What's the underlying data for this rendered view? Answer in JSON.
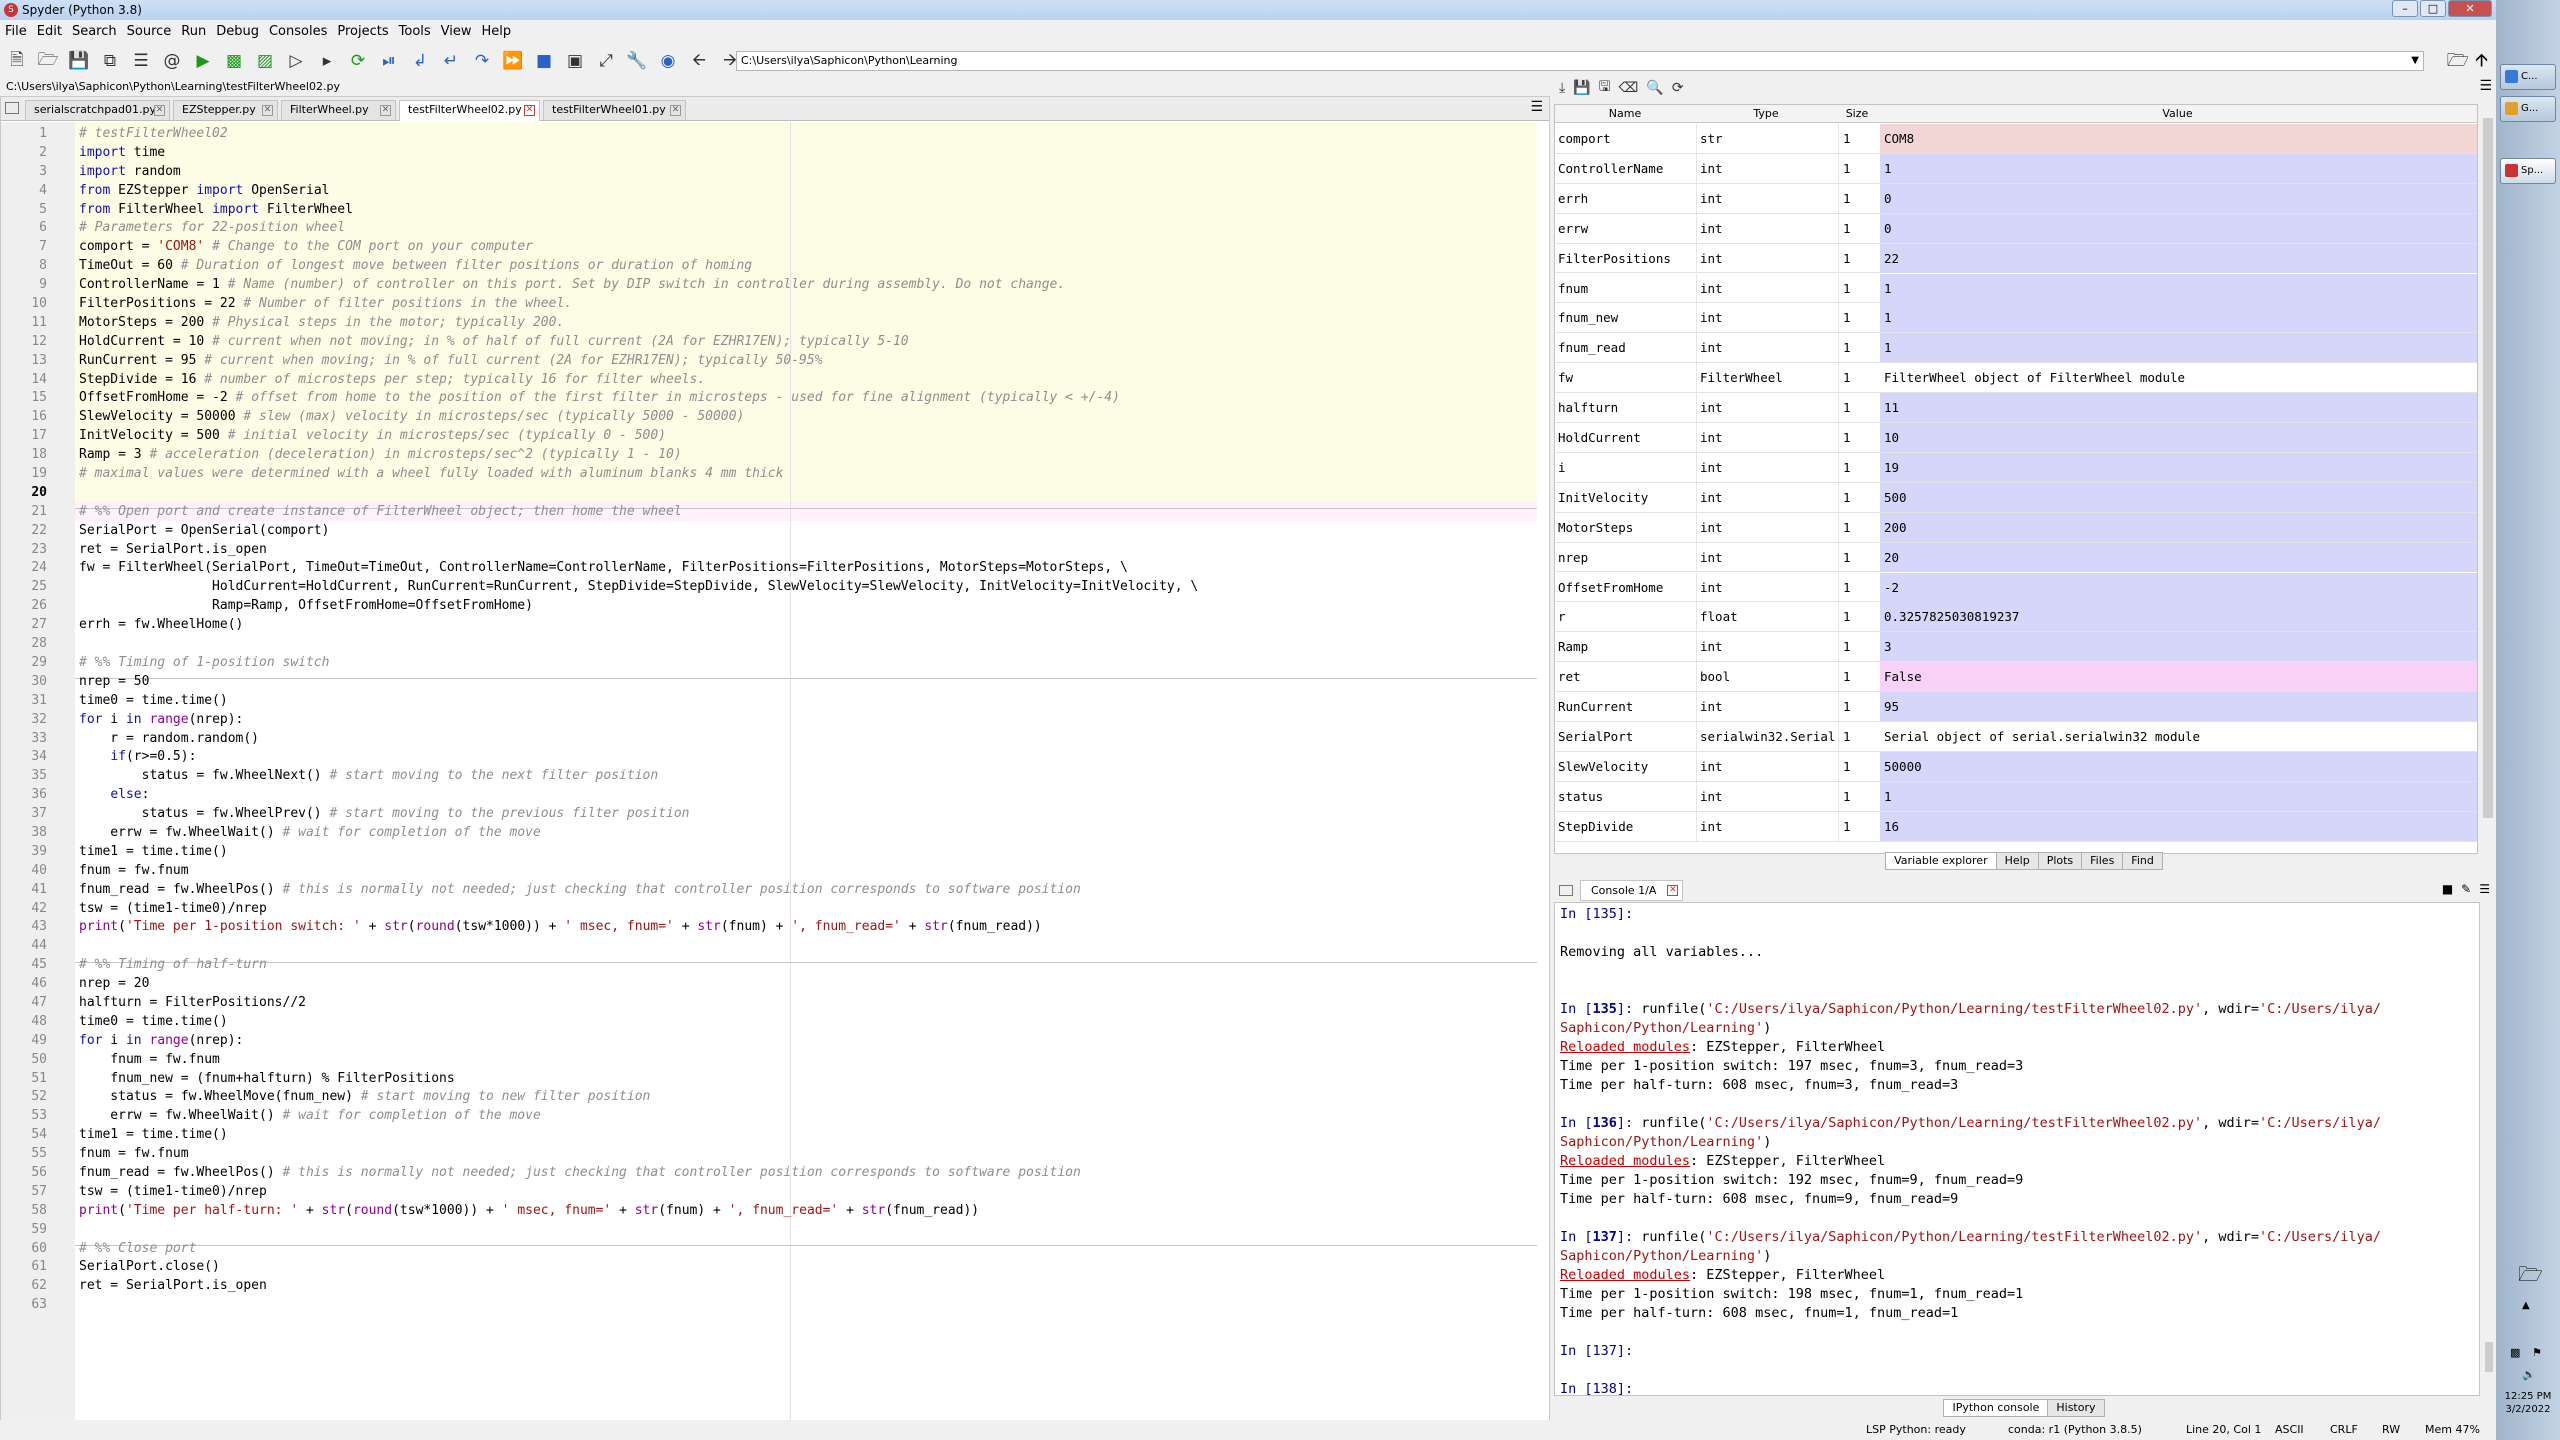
{
  "window": {
    "title": "Spyder (Python 3.8)"
  },
  "menu": [
    "File",
    "Edit",
    "Search",
    "Source",
    "Run",
    "Debug",
    "Consoles",
    "Projects",
    "Tools",
    "View",
    "Help"
  ],
  "toolbar": {
    "path": "C:\\Users\\ilya\\Saphicon\\Python\\Learning"
  },
  "editor": {
    "file_path": "C:\\Users\\ilya\\Saphicon\\Python\\Learning\\testFilterWheel02.py",
    "tabs": [
      "serialscratchpad01.py",
      "EZStepper.py",
      "FilterWheel.py",
      "testFilterWheel02.py",
      "testFilterWheel01.py"
    ],
    "active_tab": 3,
    "lines": [
      "# testFilterWheel02",
      "import time",
      "import random",
      "from EZStepper import OpenSerial",
      "from FilterWheel import FilterWheel",
      "# Parameters for 22-position wheel",
      "comport = 'COM8' # Change to the COM port on your computer",
      "TimeOut = 60 # Duration of longest move between filter positions or duration of homing",
      "ControllerName = 1 # Name (number) of controller on this port. Set by DIP switch in controller during assembly. Do not change.",
      "FilterPositions = 22 # Number of filter positions in the wheel.",
      "MotorSteps = 200 # Physical steps in the motor; typically 200.",
      "HoldCurrent = 10 # current when not moving; in % of half of full current (2A for EZHR17EN); typically 5-10",
      "RunCurrent = 95 # current when moving; in % of full current (2A for EZHR17EN); typically 50-95%",
      "StepDivide = 16 # number of microsteps per step; typically 16 for filter wheels.",
      "OffsetFromHome = -2 # offset from home to the position of the first filter in microsteps - used for fine alignment (typically < +/-4)",
      "SlewVelocity = 50000 # slew (max) velocity in microsteps/sec (typically 5000 - 50000)",
      "InitVelocity = 500 # initial velocity in microsteps/sec (typically 0 - 500)",
      "Ramp = 3 # acceleration (deceleration) in microsteps/sec^2 (typically 1 - 10)",
      "# maximal values were determined with a wheel fully loaded with aluminum blanks 4 mm thick",
      "",
      "# %% Open port and create instance of FilterWheel object; then home the wheel",
      "SerialPort = OpenSerial(comport)",
      "ret = SerialPort.is_open",
      "fw = FilterWheel(SerialPort, TimeOut=TimeOut, ControllerName=ControllerName, FilterPositions=FilterPositions, MotorSteps=MotorSteps, \\",
      "                 HoldCurrent=HoldCurrent, RunCurrent=RunCurrent, StepDivide=StepDivide, SlewVelocity=SlewVelocity, InitVelocity=InitVelocity, \\",
      "                 Ramp=Ramp, OffsetFromHome=OffsetFromHome)",
      "errh = fw.WheelHome()",
      "",
      "# %% Timing of 1-position switch",
      "nrep = 50",
      "time0 = time.time()",
      "for i in range(nrep):",
      "    r = random.random()",
      "    if(r>=0.5):",
      "        status = fw.WheelNext() # start moving to the next filter position",
      "    else:",
      "        status = fw.WheelPrev() # start moving to the previous filter position",
      "    errw = fw.WheelWait() # wait for completion of the move",
      "time1 = time.time()",
      "fnum = fw.fnum",
      "fnum_read = fw.WheelPos() # this is normally not needed; just checking that controller position corresponds to software position",
      "tsw = (time1-time0)/nrep",
      "print('Time per 1-position switch: ' + str(round(tsw*1000)) + ' msec, fnum=' + str(fnum) + ', fnum_read=' + str(fnum_read))",
      "",
      "# %% Timing of half-turn",
      "nrep = 20",
      "halfturn = FilterPositions//2",
      "time0 = time.time()",
      "for i in range(nrep):",
      "    fnum = fw.fnum",
      "    fnum_new = (fnum+halfturn) % FilterPositions",
      "    status = fw.WheelMove(fnum_new) # start moving to new filter position",
      "    errw = fw.WheelWait() # wait for completion of the move",
      "time1 = time.time()",
      "fnum = fw.fnum",
      "fnum_read = fw.WheelPos() # this is normally not needed; just checking that controller position corresponds to software position",
      "tsw = (time1-time0)/nrep",
      "print('Time per half-turn: ' + str(round(tsw*1000)) + ' msec, fnum=' + str(fnum) + ', fnum_read=' + str(fnum_read))",
      "",
      "# %% Close port",
      "SerialPort.close()",
      "ret = SerialPort.is_open",
      ""
    ],
    "current_line": 20
  },
  "variable_explorer": {
    "headers": [
      "Name",
      "Type",
      "Size",
      "Value"
    ],
    "rows": [
      {
        "name": "comport",
        "type": "str",
        "size": "1",
        "value": "COM8",
        "color": "#f2d6d6"
      },
      {
        "name": "ControllerName",
        "type": "int",
        "size": "1",
        "value": "1",
        "color": "#d6d6fa"
      },
      {
        "name": "errh",
        "type": "int",
        "size": "1",
        "value": "0",
        "color": "#d6d6fa"
      },
      {
        "name": "errw",
        "type": "int",
        "size": "1",
        "value": "0",
        "color": "#d6d6fa"
      },
      {
        "name": "FilterPositions",
        "type": "int",
        "size": "1",
        "value": "22",
        "color": "#d6d6fa"
      },
      {
        "name": "fnum",
        "type": "int",
        "size": "1",
        "value": "1",
        "color": "#d6d6fa"
      },
      {
        "name": "fnum_new",
        "type": "int",
        "size": "1",
        "value": "1",
        "color": "#d6d6fa"
      },
      {
        "name": "fnum_read",
        "type": "int",
        "size": "1",
        "value": "1",
        "color": "#d6d6fa"
      },
      {
        "name": "fw",
        "type": "FilterWheel",
        "size": "1",
        "value": "FilterWheel object of FilterWheel module",
        "color": "#ffffff"
      },
      {
        "name": "halfturn",
        "type": "int",
        "size": "1",
        "value": "11",
        "color": "#d6d6fa"
      },
      {
        "name": "HoldCurrent",
        "type": "int",
        "size": "1",
        "value": "10",
        "color": "#d6d6fa"
      },
      {
        "name": "i",
        "type": "int",
        "size": "1",
        "value": "19",
        "color": "#d6d6fa"
      },
      {
        "name": "InitVelocity",
        "type": "int",
        "size": "1",
        "value": "500",
        "color": "#d6d6fa"
      },
      {
        "name": "MotorSteps",
        "type": "int",
        "size": "1",
        "value": "200",
        "color": "#d6d6fa"
      },
      {
        "name": "nrep",
        "type": "int",
        "size": "1",
        "value": "20",
        "color": "#d6d6fa"
      },
      {
        "name": "OffsetFromHome",
        "type": "int",
        "size": "1",
        "value": "-2",
        "color": "#d6d6fa"
      },
      {
        "name": "r",
        "type": "float",
        "size": "1",
        "value": "0.3257825030819237",
        "color": "#d6d6fa"
      },
      {
        "name": "Ramp",
        "type": "int",
        "size": "1",
        "value": "3",
        "color": "#d6d6fa"
      },
      {
        "name": "ret",
        "type": "bool",
        "size": "1",
        "value": "False",
        "color": "#f8d2f6"
      },
      {
        "name": "RunCurrent",
        "type": "int",
        "size": "1",
        "value": "95",
        "color": "#d6d6fa"
      },
      {
        "name": "SerialPort",
        "type": "serialwin32.Serial",
        "size": "1",
        "value": "Serial object of serial.serialwin32 module",
        "color": "#ffffff"
      },
      {
        "name": "SlewVelocity",
        "type": "int",
        "size": "1",
        "value": "50000",
        "color": "#d6d6fa"
      },
      {
        "name": "status",
        "type": "int",
        "size": "1",
        "value": "1",
        "color": "#d6d6fa"
      },
      {
        "name": "StepDivide",
        "type": "int",
        "size": "1",
        "value": "16",
        "color": "#d6d6fa"
      }
    ],
    "tabs": [
      "Variable explorer",
      "Help",
      "Plots",
      "Files",
      "Find"
    ]
  },
  "console": {
    "tab": "Console 1/A",
    "lines": [
      {
        "kind": "prompt",
        "text": "In [135]:"
      },
      {
        "kind": "plain",
        "text": ""
      },
      {
        "kind": "plain",
        "text": "Removing all variables..."
      },
      {
        "kind": "plain",
        "text": ""
      },
      {
        "kind": "plain",
        "text": ""
      },
      {
        "kind": "run",
        "num": "135",
        "a": "runfile(",
        "s1": "'C:/Users/ilya/Saphicon/Python/Learning/testFilterWheel02.py'",
        "b": ", wdir=",
        "s2": "'C:/Users/ilya/"
      },
      {
        "kind": "str",
        "text": "Saphicon/Python/Learning'",
        "tail": ")"
      },
      {
        "kind": "warn",
        "label": "Reloaded modules",
        "text": ": EZStepper, FilterWheel"
      },
      {
        "kind": "plain",
        "text": "Time per 1-position switch: 197 msec, fnum=3, fnum_read=3"
      },
      {
        "kind": "plain",
        "text": "Time per half-turn: 608 msec, fnum=3, fnum_read=3"
      },
      {
        "kind": "plain",
        "text": ""
      },
      {
        "kind": "run",
        "num": "136",
        "a": "runfile(",
        "s1": "'C:/Users/ilya/Saphicon/Python/Learning/testFilterWheel02.py'",
        "b": ", wdir=",
        "s2": "'C:/Users/ilya/"
      },
      {
        "kind": "str",
        "text": "Saphicon/Python/Learning'",
        "tail": ")"
      },
      {
        "kind": "warn",
        "label": "Reloaded modules",
        "text": ": EZStepper, FilterWheel"
      },
      {
        "kind": "plain",
        "text": "Time per 1-position switch: 192 msec, fnum=9, fnum_read=9"
      },
      {
        "kind": "plain",
        "text": "Time per half-turn: 608 msec, fnum=9, fnum_read=9"
      },
      {
        "kind": "plain",
        "text": ""
      },
      {
        "kind": "run",
        "num": "137",
        "a": "runfile(",
        "s1": "'C:/Users/ilya/Saphicon/Python/Learning/testFilterWheel02.py'",
        "b": ", wdir=",
        "s2": "'C:/Users/ilya/"
      },
      {
        "kind": "str",
        "text": "Saphicon/Python/Learning'",
        "tail": ")"
      },
      {
        "kind": "warn",
        "label": "Reloaded modules",
        "text": ": EZStepper, FilterWheel"
      },
      {
        "kind": "plain",
        "text": "Time per 1-position switch: 198 msec, fnum=1, fnum_read=1"
      },
      {
        "kind": "plain",
        "text": "Time per half-turn: 608 msec, fnum=1, fnum_read=1"
      },
      {
        "kind": "plain",
        "text": ""
      },
      {
        "kind": "prompt",
        "text": "In [137]:"
      },
      {
        "kind": "plain",
        "text": ""
      },
      {
        "kind": "prompt",
        "text": "In [138]:"
      }
    ],
    "tabs": [
      "IPython console",
      "History"
    ]
  },
  "statusbar": {
    "lsp": "LSP Python: ready",
    "conda": "conda: r1 (Python 3.8.5)",
    "position": "Line 20, Col 1",
    "encoding": "ASCII",
    "eol": "CRLF",
    "permissions": "RW",
    "memory": "Mem 47%"
  },
  "taskbar": {
    "items": [
      "C...",
      "G...",
      "Sp..."
    ],
    "time": "12:25 PM",
    "date": "3/2/2022"
  }
}
